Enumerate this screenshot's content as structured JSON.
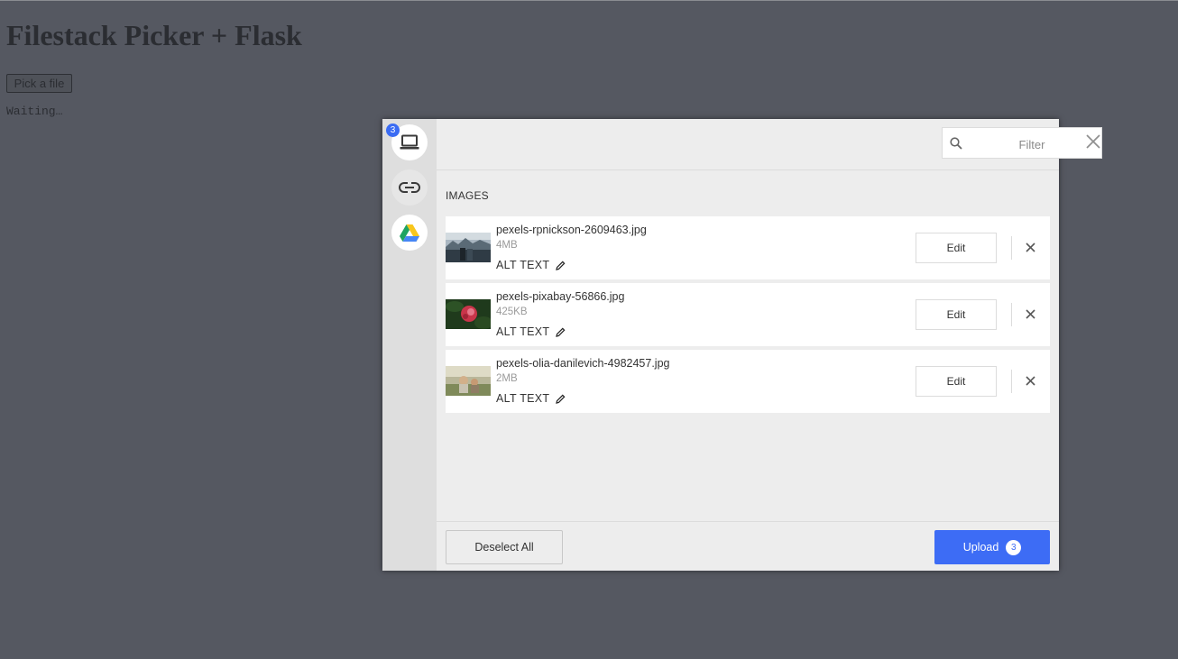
{
  "page": {
    "title": "Filestack Picker + Flask",
    "pick_button": "Pick a file",
    "status": "Waiting…"
  },
  "picker": {
    "sources": [
      {
        "name": "My Device",
        "icon": "laptop-icon",
        "badge": "3"
      },
      {
        "name": "Link",
        "icon": "link-icon"
      },
      {
        "name": "Google Drive",
        "icon": "google-drive-icon"
      }
    ],
    "filter": {
      "placeholder": "Filter",
      "value": ""
    },
    "section_label": "IMAGES",
    "files": [
      {
        "name": "pexels-rpnickson-2609463.jpg",
        "size": "4MB",
        "alt_label": "ALT TEXT",
        "edit_label": "Edit"
      },
      {
        "name": "pexels-pixabay-56866.jpg",
        "size": "425KB",
        "alt_label": "ALT TEXT",
        "edit_label": "Edit"
      },
      {
        "name": "pexels-olia-danilevich-4982457.jpg",
        "size": "2MB",
        "alt_label": "ALT TEXT",
        "edit_label": "Edit"
      }
    ],
    "footer": {
      "deselect_label": "Deselect All",
      "upload_label": "Upload",
      "upload_count": "3"
    },
    "colors": {
      "accent": "#3d6cf5",
      "backdrop": "#555861",
      "panel": "#ededed",
      "sidebar": "#dedede"
    }
  }
}
